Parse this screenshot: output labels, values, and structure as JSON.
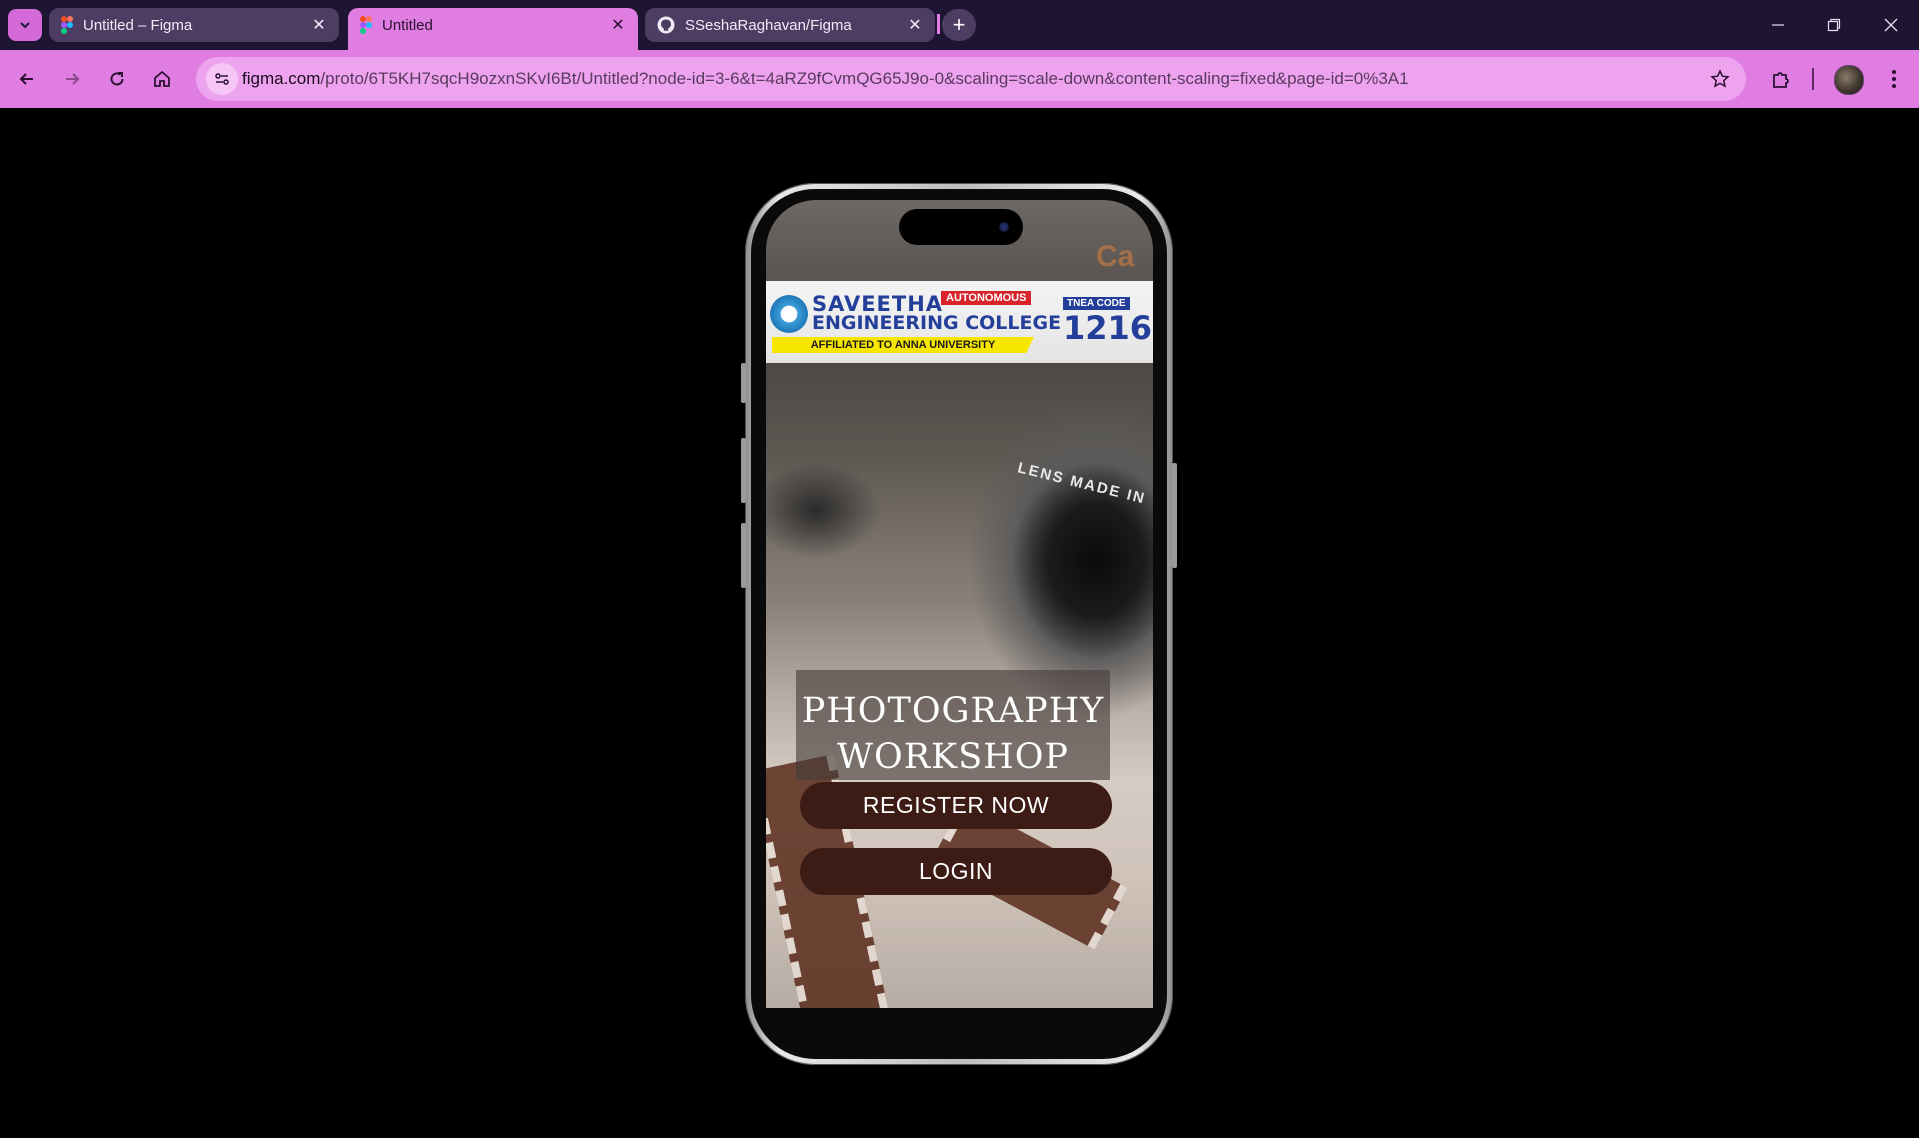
{
  "browser": {
    "tabs": [
      {
        "title": "Untitled – Figma",
        "icon": "figma-icon",
        "active": false
      },
      {
        "title": "Untitled",
        "icon": "figma-icon",
        "active": true
      },
      {
        "title": "SSeshaRaghavan/Figma",
        "icon": "github-icon",
        "active": false
      }
    ],
    "url_host": "figma.com",
    "url_path": "/proto/6T5KH7sqcH9ozxnSKvI6Bt/Untitled?node-id=3-6&t=4aRZ9fCvmQG65J9o-0&scaling=scale-down&content-scaling=fixed&page-id=0%3A1",
    "accent_color": "#e07de2",
    "tabstrip_color": "#1e1533"
  },
  "prototype": {
    "banner": {
      "college_line_1": "SAVEETHA",
      "college_line_2": "ENGINEERING COLLEGE",
      "badge": "AUTONOMOUS",
      "affiliation": "AFFILIATED TO ANNA UNIVERSITY",
      "tnea_label": "TNEA CODE",
      "tnea_code": "1216"
    },
    "camera_brand": "Ca",
    "lens_text": "LENS MADE IN",
    "title_line_1": "PHOTOGRAPHY",
    "title_line_2": "WORKSHOP",
    "register_button": "REGISTER NOW",
    "login_button": "LOGIN",
    "button_color": "#3e1c16"
  }
}
